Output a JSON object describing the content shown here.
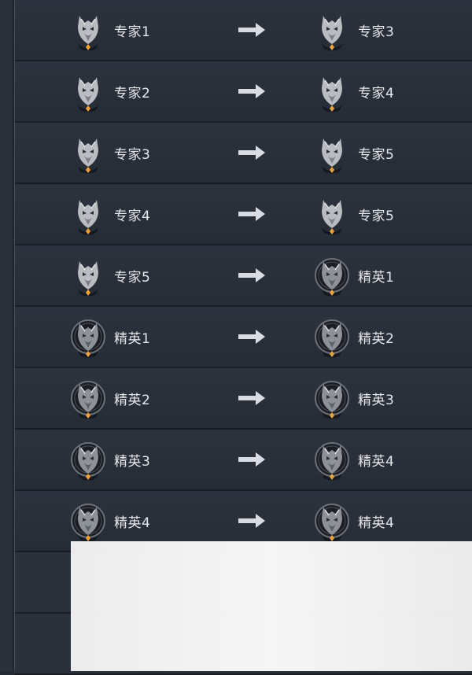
{
  "rows": [
    {
      "from": {
        "label": "专家1",
        "tier": "expert"
      },
      "to": {
        "label": "专家3",
        "tier": "expert"
      }
    },
    {
      "from": {
        "label": "专家2",
        "tier": "expert"
      },
      "to": {
        "label": "专家4",
        "tier": "expert"
      }
    },
    {
      "from": {
        "label": "专家3",
        "tier": "expert"
      },
      "to": {
        "label": "专家5",
        "tier": "expert"
      }
    },
    {
      "from": {
        "label": "专家4",
        "tier": "expert"
      },
      "to": {
        "label": "专家5",
        "tier": "expert"
      }
    },
    {
      "from": {
        "label": "专家5",
        "tier": "expert"
      },
      "to": {
        "label": "精英1",
        "tier": "elite"
      }
    },
    {
      "from": {
        "label": "精英1",
        "tier": "elite"
      },
      "to": {
        "label": "精英2",
        "tier": "elite"
      }
    },
    {
      "from": {
        "label": "精英2",
        "tier": "elite"
      },
      "to": {
        "label": "精英3",
        "tier": "elite"
      }
    },
    {
      "from": {
        "label": "精英3",
        "tier": "elite"
      },
      "to": {
        "label": "精英4",
        "tier": "elite"
      }
    },
    {
      "from": {
        "label": "精英4",
        "tier": "elite"
      },
      "to": {
        "label": "精英4",
        "tier": "elite"
      }
    }
  ],
  "icons": {
    "expert": "wolf-expert-rank-icon",
    "elite": "wolf-elite-rank-icon",
    "arrow": "arrow-right-icon"
  },
  "colors": {
    "background": "#252b34",
    "row": "#2a313b",
    "text": "#e6e8ec",
    "arrow": "#d9dde3",
    "emblem_gem": "#f0a23a"
  }
}
